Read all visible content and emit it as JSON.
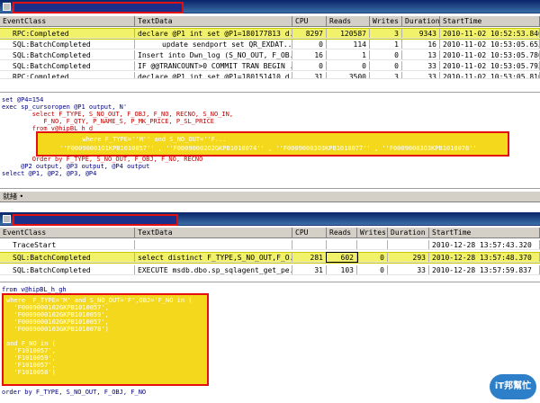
{
  "top": {
    "columns": [
      "EventClass",
      "TextData",
      "CPU",
      "Reads",
      "Writes",
      "Duration",
      "StartTime"
    ],
    "rows": [
      [
        "RPC:Completed",
        "declare @P1 int set @P1=180177813 d...",
        "8297",
        "120587",
        "3",
        "9343",
        "2010-11-02 10:52:53.840"
      ],
      [
        "SQL:BatchCompleted",
        "update sendport set QR_EXDAT...",
        "0",
        "114",
        "1",
        "16",
        "2010-11-02 10:53:05.653"
      ],
      [
        "SQL:BatchCompleted",
        "Insert into Dwn_log (S_NO_OUT, F_OB...",
        "16",
        "1",
        "0",
        "13",
        "2010-11-02 10:53:05.780"
      ],
      [
        "SQL:BatchCompleted",
        "IF @@TRANCOUNT>0 COMMIT TRAN BEGIN ...",
        "0",
        "0",
        "0",
        "33",
        "2010-11-02 10:53:05.793"
      ],
      [
        "RPC:Completed",
        "declare @P1 int set @P1=180151410 d...",
        "31",
        "3500",
        "3",
        "33",
        "2010-11-02 10:53:05.810"
      ]
    ]
  },
  "top_text": {
    "l1": "set @P4=154",
    "l2": "exec sp_cursoropen @P1 output, N'",
    "l3": "        select F_TYPE, S_NO_OUT, F_OBJ, F_NO, RECNO, S_NO_IN,",
    "l4": "           F_NO, F_QTY, P_NAME_S, P_MK_PRICE, P_SL_PRICE",
    "l5": "        from v@hipBL_h_d",
    "hl1": "           where F_TYPE=''M'' and S_NO_OUT=''F...",
    "hl2": "     ''F00090001O1KPB1010057'' , ''F00090002O2GKPB1010074'' , ''F00090003O3KPB1010077'' , ''F00090003O3KPB1010078''",
    "l6": "        Order by F_TYPE, S_NO_OUT, F_OBJ, F_NO, RECNO",
    "l7": "     @P2 output, @P3 output, @P4 output",
    "l8": "select @P1, @P2, @P3, @P4"
  },
  "status": {
    "text": "就緒 •"
  },
  "bottom": {
    "columns": [
      "EventClass",
      "TextData",
      "CPU",
      "Reads",
      "Writes",
      "Duration",
      "StartTime"
    ],
    "rows": [
      [
        "TraceStart",
        "",
        "",
        "",
        "",
        "",
        "2010-12-28 13:57:43.320"
      ],
      [
        "SQL:BatchCompleted",
        "select distinct F_TYPE,S_NO_OUT,F_O...",
        "281",
        "602",
        "0",
        "293",
        "2010-12-28 13:57:48.370"
      ],
      [
        "SQL:BatchCompleted",
        "EXECUTE msdb.dbo.sp_sqlagent_get_pe...",
        "31",
        "103",
        "0",
        "33",
        "2010-12-28 13:57:59.837"
      ]
    ]
  },
  "bottom_text": {
    "l1": "from v@hipBL_h_gh",
    "hl1": "where  F_TYPE='M' and S_NO_OUT='F',OBJ='F_NO in (",
    "hl2": "  'F0009000102GKPB1010057',",
    "hl3": "  'F0009000102GKPB1010059',",
    "hl4": "  'F0009000102GKPB1010057',",
    "hl5": "  'F0009000103GKPB1010078')",
    "hl6": "",
    "hl7": "and F_NO in (",
    "hl8": "  'F1010057',",
    "hl9": "  'F1010059',",
    "hl10": "  'F1010057',",
    "hl11": "  'F1010058')",
    "l2": "order by F_TYPE, S_NO_OUT, F_OBJ, F_NO"
  },
  "logo": {
    "text": "iT邦幫忙"
  }
}
